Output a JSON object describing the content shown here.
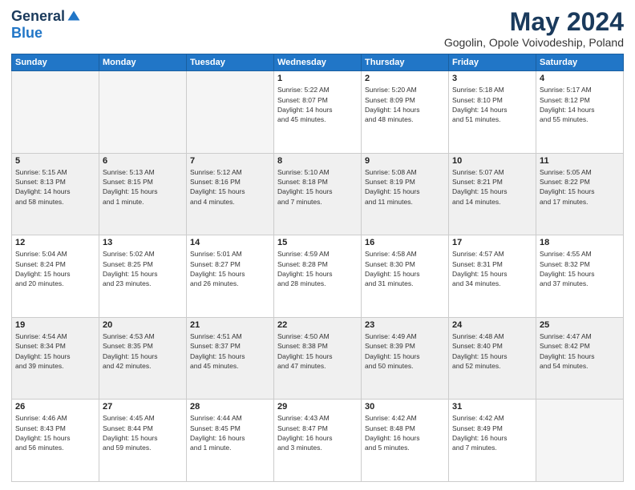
{
  "logo": {
    "general": "General",
    "blue": "Blue"
  },
  "header": {
    "month_year": "May 2024",
    "location": "Gogolin, Opole Voivodeship, Poland"
  },
  "weekdays": [
    "Sunday",
    "Monday",
    "Tuesday",
    "Wednesday",
    "Thursday",
    "Friday",
    "Saturday"
  ],
  "weeks": [
    [
      {
        "day": "",
        "info": ""
      },
      {
        "day": "",
        "info": ""
      },
      {
        "day": "",
        "info": ""
      },
      {
        "day": "1",
        "info": "Sunrise: 5:22 AM\nSunset: 8:07 PM\nDaylight: 14 hours\nand 45 minutes."
      },
      {
        "day": "2",
        "info": "Sunrise: 5:20 AM\nSunset: 8:09 PM\nDaylight: 14 hours\nand 48 minutes."
      },
      {
        "day": "3",
        "info": "Sunrise: 5:18 AM\nSunset: 8:10 PM\nDaylight: 14 hours\nand 51 minutes."
      },
      {
        "day": "4",
        "info": "Sunrise: 5:17 AM\nSunset: 8:12 PM\nDaylight: 14 hours\nand 55 minutes."
      }
    ],
    [
      {
        "day": "5",
        "info": "Sunrise: 5:15 AM\nSunset: 8:13 PM\nDaylight: 14 hours\nand 58 minutes."
      },
      {
        "day": "6",
        "info": "Sunrise: 5:13 AM\nSunset: 8:15 PM\nDaylight: 15 hours\nand 1 minute."
      },
      {
        "day": "7",
        "info": "Sunrise: 5:12 AM\nSunset: 8:16 PM\nDaylight: 15 hours\nand 4 minutes."
      },
      {
        "day": "8",
        "info": "Sunrise: 5:10 AM\nSunset: 8:18 PM\nDaylight: 15 hours\nand 7 minutes."
      },
      {
        "day": "9",
        "info": "Sunrise: 5:08 AM\nSunset: 8:19 PM\nDaylight: 15 hours\nand 11 minutes."
      },
      {
        "day": "10",
        "info": "Sunrise: 5:07 AM\nSunset: 8:21 PM\nDaylight: 15 hours\nand 14 minutes."
      },
      {
        "day": "11",
        "info": "Sunrise: 5:05 AM\nSunset: 8:22 PM\nDaylight: 15 hours\nand 17 minutes."
      }
    ],
    [
      {
        "day": "12",
        "info": "Sunrise: 5:04 AM\nSunset: 8:24 PM\nDaylight: 15 hours\nand 20 minutes."
      },
      {
        "day": "13",
        "info": "Sunrise: 5:02 AM\nSunset: 8:25 PM\nDaylight: 15 hours\nand 23 minutes."
      },
      {
        "day": "14",
        "info": "Sunrise: 5:01 AM\nSunset: 8:27 PM\nDaylight: 15 hours\nand 26 minutes."
      },
      {
        "day": "15",
        "info": "Sunrise: 4:59 AM\nSunset: 8:28 PM\nDaylight: 15 hours\nand 28 minutes."
      },
      {
        "day": "16",
        "info": "Sunrise: 4:58 AM\nSunset: 8:30 PM\nDaylight: 15 hours\nand 31 minutes."
      },
      {
        "day": "17",
        "info": "Sunrise: 4:57 AM\nSunset: 8:31 PM\nDaylight: 15 hours\nand 34 minutes."
      },
      {
        "day": "18",
        "info": "Sunrise: 4:55 AM\nSunset: 8:32 PM\nDaylight: 15 hours\nand 37 minutes."
      }
    ],
    [
      {
        "day": "19",
        "info": "Sunrise: 4:54 AM\nSunset: 8:34 PM\nDaylight: 15 hours\nand 39 minutes."
      },
      {
        "day": "20",
        "info": "Sunrise: 4:53 AM\nSunset: 8:35 PM\nDaylight: 15 hours\nand 42 minutes."
      },
      {
        "day": "21",
        "info": "Sunrise: 4:51 AM\nSunset: 8:37 PM\nDaylight: 15 hours\nand 45 minutes."
      },
      {
        "day": "22",
        "info": "Sunrise: 4:50 AM\nSunset: 8:38 PM\nDaylight: 15 hours\nand 47 minutes."
      },
      {
        "day": "23",
        "info": "Sunrise: 4:49 AM\nSunset: 8:39 PM\nDaylight: 15 hours\nand 50 minutes."
      },
      {
        "day": "24",
        "info": "Sunrise: 4:48 AM\nSunset: 8:40 PM\nDaylight: 15 hours\nand 52 minutes."
      },
      {
        "day": "25",
        "info": "Sunrise: 4:47 AM\nSunset: 8:42 PM\nDaylight: 15 hours\nand 54 minutes."
      }
    ],
    [
      {
        "day": "26",
        "info": "Sunrise: 4:46 AM\nSunset: 8:43 PM\nDaylight: 15 hours\nand 56 minutes."
      },
      {
        "day": "27",
        "info": "Sunrise: 4:45 AM\nSunset: 8:44 PM\nDaylight: 15 hours\nand 59 minutes."
      },
      {
        "day": "28",
        "info": "Sunrise: 4:44 AM\nSunset: 8:45 PM\nDaylight: 16 hours\nand 1 minute."
      },
      {
        "day": "29",
        "info": "Sunrise: 4:43 AM\nSunset: 8:47 PM\nDaylight: 16 hours\nand 3 minutes."
      },
      {
        "day": "30",
        "info": "Sunrise: 4:42 AM\nSunset: 8:48 PM\nDaylight: 16 hours\nand 5 minutes."
      },
      {
        "day": "31",
        "info": "Sunrise: 4:42 AM\nSunset: 8:49 PM\nDaylight: 16 hours\nand 7 minutes."
      },
      {
        "day": "",
        "info": ""
      }
    ]
  ]
}
